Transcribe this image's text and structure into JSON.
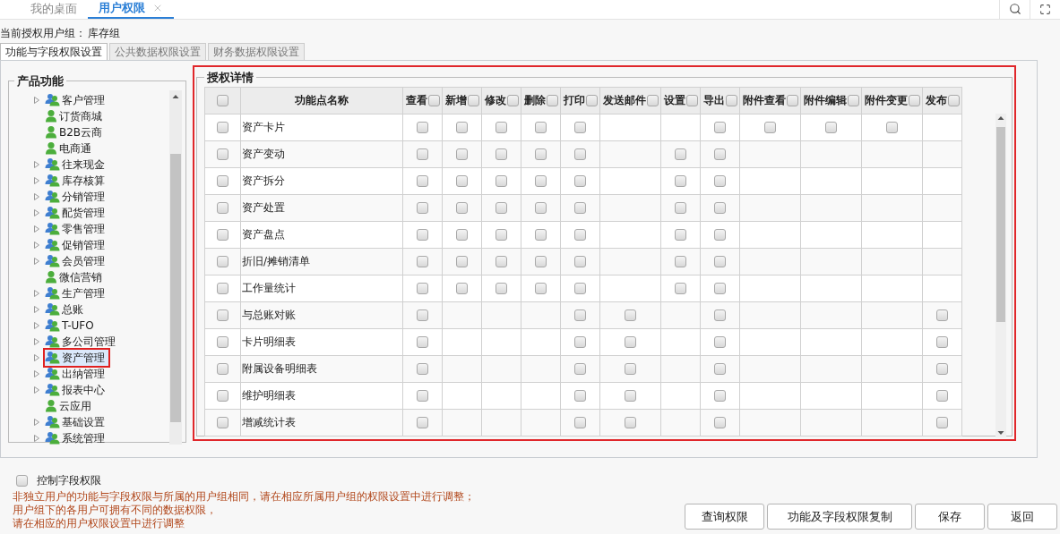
{
  "tabs": [
    {
      "label": "我的桌面",
      "selected": false,
      "closable": false
    },
    {
      "label": "用户权限",
      "selected": true,
      "closable": true
    }
  ],
  "user_group": {
    "label": "当前授权用户组：",
    "value": "库存组"
  },
  "sub_tabs": [
    {
      "label": "功能与字段权限设置",
      "selected": true
    },
    {
      "label": "公共数据权限设置",
      "selected": false
    },
    {
      "label": "财务数据权限设置",
      "selected": false
    }
  ],
  "tree": {
    "title": "产品功能",
    "items": [
      {
        "label": "客户管理",
        "kind": "group",
        "selected": false
      },
      {
        "label": "订货商城",
        "kind": "leaf",
        "selected": false
      },
      {
        "label": "B2B云商",
        "kind": "leaf",
        "selected": false
      },
      {
        "label": "电商通",
        "kind": "leaf",
        "selected": false
      },
      {
        "label": "往来现金",
        "kind": "group",
        "selected": false
      },
      {
        "label": "库存核算",
        "kind": "group",
        "selected": false
      },
      {
        "label": "分销管理",
        "kind": "group",
        "selected": false
      },
      {
        "label": "配货管理",
        "kind": "group",
        "selected": false
      },
      {
        "label": "零售管理",
        "kind": "group",
        "selected": false
      },
      {
        "label": "促销管理",
        "kind": "group",
        "selected": false
      },
      {
        "label": "会员管理",
        "kind": "group",
        "selected": false
      },
      {
        "label": "微信营销",
        "kind": "leaf",
        "selected": false
      },
      {
        "label": "生产管理",
        "kind": "group",
        "selected": false
      },
      {
        "label": "总账",
        "kind": "group",
        "selected": false
      },
      {
        "label": "T-UFO",
        "kind": "group",
        "selected": false
      },
      {
        "label": "多公司管理",
        "kind": "group",
        "selected": false
      },
      {
        "label": "资产管理",
        "kind": "group",
        "selected": true
      },
      {
        "label": "出纳管理",
        "kind": "group",
        "selected": false
      },
      {
        "label": "报表中心",
        "kind": "group",
        "selected": false
      },
      {
        "label": "云应用",
        "kind": "leaf",
        "selected": false
      },
      {
        "label": "基础设置",
        "kind": "group",
        "selected": false
      },
      {
        "label": "系统管理",
        "kind": "group",
        "selected": false
      }
    ]
  },
  "details": {
    "title": "授权详情",
    "all_checked": false,
    "columns": [
      {
        "label": "功能点名称"
      },
      {
        "label": "查看",
        "checked": false
      },
      {
        "label": "新增",
        "checked": false
      },
      {
        "label": "修改",
        "checked": false
      },
      {
        "label": "删除",
        "checked": false
      },
      {
        "label": "打印",
        "checked": false
      },
      {
        "label": "发送邮件",
        "checked": false
      },
      {
        "label": "设置",
        "checked": false
      },
      {
        "label": "导出",
        "checked": false
      },
      {
        "label": "附件查看",
        "checked": false
      },
      {
        "label": "附件编辑",
        "checked": false
      },
      {
        "label": "附件变更",
        "checked": false
      },
      {
        "label": "发布",
        "checked": false
      }
    ],
    "rows": [
      {
        "name": "资产卡片",
        "checked": false,
        "cells": [
          {
            "kind": "checkbox",
            "checked": false
          },
          {
            "kind": "checkbox",
            "checked": false
          },
          {
            "kind": "checkbox",
            "checked": false
          },
          {
            "kind": "checkbox",
            "checked": false
          },
          {
            "kind": "checkbox",
            "checked": false
          },
          {
            "kind": "blank"
          },
          {
            "kind": "blank"
          },
          {
            "kind": "checkbox",
            "checked": false
          },
          {
            "kind": "checkbox",
            "checked": false
          },
          {
            "kind": "checkbox",
            "checked": false
          },
          {
            "kind": "checkbox",
            "checked": false
          },
          {
            "kind": "blank"
          }
        ]
      },
      {
        "name": "资产变动",
        "checked": false,
        "cells": [
          {
            "kind": "checkbox",
            "checked": false
          },
          {
            "kind": "checkbox",
            "checked": false
          },
          {
            "kind": "checkbox",
            "checked": false
          },
          {
            "kind": "checkbox",
            "checked": false
          },
          {
            "kind": "checkbox",
            "checked": false
          },
          {
            "kind": "blank"
          },
          {
            "kind": "checkbox",
            "checked": false
          },
          {
            "kind": "checkbox",
            "checked": false
          },
          {
            "kind": "blank"
          },
          {
            "kind": "blank"
          },
          {
            "kind": "blank"
          },
          {
            "kind": "blank"
          }
        ]
      },
      {
        "name": "资产拆分",
        "checked": false,
        "cells": [
          {
            "kind": "checkbox",
            "checked": false
          },
          {
            "kind": "checkbox",
            "checked": false
          },
          {
            "kind": "checkbox",
            "checked": false
          },
          {
            "kind": "checkbox",
            "checked": false
          },
          {
            "kind": "checkbox",
            "checked": false
          },
          {
            "kind": "blank"
          },
          {
            "kind": "checkbox",
            "checked": false
          },
          {
            "kind": "checkbox",
            "checked": false
          },
          {
            "kind": "blank"
          },
          {
            "kind": "blank"
          },
          {
            "kind": "blank"
          },
          {
            "kind": "blank"
          }
        ]
      },
      {
        "name": "资产处置",
        "checked": false,
        "cells": [
          {
            "kind": "checkbox",
            "checked": false
          },
          {
            "kind": "checkbox",
            "checked": false
          },
          {
            "kind": "checkbox",
            "checked": false
          },
          {
            "kind": "checkbox",
            "checked": false
          },
          {
            "kind": "checkbox",
            "checked": false
          },
          {
            "kind": "blank"
          },
          {
            "kind": "checkbox",
            "checked": false
          },
          {
            "kind": "checkbox",
            "checked": false
          },
          {
            "kind": "blank"
          },
          {
            "kind": "blank"
          },
          {
            "kind": "blank"
          },
          {
            "kind": "blank"
          }
        ]
      },
      {
        "name": "资产盘点",
        "checked": false,
        "cells": [
          {
            "kind": "checkbox",
            "checked": false
          },
          {
            "kind": "checkbox",
            "checked": false
          },
          {
            "kind": "checkbox",
            "checked": false
          },
          {
            "kind": "checkbox",
            "checked": false
          },
          {
            "kind": "checkbox",
            "checked": false
          },
          {
            "kind": "blank"
          },
          {
            "kind": "checkbox",
            "checked": false
          },
          {
            "kind": "checkbox",
            "checked": false
          },
          {
            "kind": "blank"
          },
          {
            "kind": "blank"
          },
          {
            "kind": "blank"
          },
          {
            "kind": "blank"
          }
        ]
      },
      {
        "name": "折旧/摊销清单",
        "checked": false,
        "cells": [
          {
            "kind": "checkbox",
            "checked": false
          },
          {
            "kind": "checkbox",
            "checked": false
          },
          {
            "kind": "checkbox",
            "checked": false
          },
          {
            "kind": "checkbox",
            "checked": false
          },
          {
            "kind": "checkbox",
            "checked": false
          },
          {
            "kind": "blank"
          },
          {
            "kind": "checkbox",
            "checked": false
          },
          {
            "kind": "checkbox",
            "checked": false
          },
          {
            "kind": "blank"
          },
          {
            "kind": "blank"
          },
          {
            "kind": "blank"
          },
          {
            "kind": "blank"
          }
        ]
      },
      {
        "name": "工作量统计",
        "checked": false,
        "cells": [
          {
            "kind": "checkbox",
            "checked": false
          },
          {
            "kind": "checkbox",
            "checked": false
          },
          {
            "kind": "checkbox",
            "checked": false
          },
          {
            "kind": "checkbox",
            "checked": false
          },
          {
            "kind": "checkbox",
            "checked": false
          },
          {
            "kind": "blank"
          },
          {
            "kind": "checkbox",
            "checked": false
          },
          {
            "kind": "checkbox",
            "checked": false
          },
          {
            "kind": "blank"
          },
          {
            "kind": "blank"
          },
          {
            "kind": "blank"
          },
          {
            "kind": "blank"
          }
        ]
      },
      {
        "name": "与总账对账",
        "checked": false,
        "cells": [
          {
            "kind": "checkbox",
            "checked": false
          },
          {
            "kind": "blank"
          },
          {
            "kind": "blank"
          },
          {
            "kind": "blank"
          },
          {
            "kind": "checkbox",
            "checked": false
          },
          {
            "kind": "checkbox",
            "checked": false
          },
          {
            "kind": "blank"
          },
          {
            "kind": "checkbox",
            "checked": false
          },
          {
            "kind": "blank"
          },
          {
            "kind": "blank"
          },
          {
            "kind": "blank"
          },
          {
            "kind": "checkbox",
            "checked": false
          }
        ]
      },
      {
        "name": "卡片明细表",
        "checked": false,
        "cells": [
          {
            "kind": "checkbox",
            "checked": false
          },
          {
            "kind": "blank"
          },
          {
            "kind": "blank"
          },
          {
            "kind": "blank"
          },
          {
            "kind": "checkbox",
            "checked": false
          },
          {
            "kind": "checkbox",
            "checked": false
          },
          {
            "kind": "blank"
          },
          {
            "kind": "checkbox",
            "checked": false
          },
          {
            "kind": "blank"
          },
          {
            "kind": "blank"
          },
          {
            "kind": "blank"
          },
          {
            "kind": "checkbox",
            "checked": false
          }
        ]
      },
      {
        "name": "附属设备明细表",
        "checked": false,
        "cells": [
          {
            "kind": "checkbox",
            "checked": false
          },
          {
            "kind": "blank"
          },
          {
            "kind": "blank"
          },
          {
            "kind": "blank"
          },
          {
            "kind": "checkbox",
            "checked": false
          },
          {
            "kind": "checkbox",
            "checked": false
          },
          {
            "kind": "blank"
          },
          {
            "kind": "checkbox",
            "checked": false
          },
          {
            "kind": "blank"
          },
          {
            "kind": "blank"
          },
          {
            "kind": "blank"
          },
          {
            "kind": "checkbox",
            "checked": false
          }
        ]
      },
      {
        "name": "维护明细表",
        "checked": false,
        "cells": [
          {
            "kind": "checkbox",
            "checked": false
          },
          {
            "kind": "blank"
          },
          {
            "kind": "blank"
          },
          {
            "kind": "blank"
          },
          {
            "kind": "checkbox",
            "checked": false
          },
          {
            "kind": "checkbox",
            "checked": false
          },
          {
            "kind": "blank"
          },
          {
            "kind": "checkbox",
            "checked": false
          },
          {
            "kind": "blank"
          },
          {
            "kind": "blank"
          },
          {
            "kind": "blank"
          },
          {
            "kind": "checkbox",
            "checked": false
          }
        ]
      },
      {
        "name": "增减统计表",
        "checked": false,
        "cells": [
          {
            "kind": "checkbox",
            "checked": false
          },
          {
            "kind": "blank"
          },
          {
            "kind": "blank"
          },
          {
            "kind": "blank"
          },
          {
            "kind": "checkbox",
            "checked": false
          },
          {
            "kind": "checkbox",
            "checked": false
          },
          {
            "kind": "blank"
          },
          {
            "kind": "checkbox",
            "checked": false
          },
          {
            "kind": "blank"
          },
          {
            "kind": "blank"
          },
          {
            "kind": "blank"
          },
          {
            "kind": "checkbox",
            "checked": false
          }
        ]
      }
    ]
  },
  "field_control": {
    "label": "控制字段权限",
    "checked": false
  },
  "notes": [
    "非独立用户的功能与字段权限与所属的用户组相同，请在相应所属用户组的权限设置中进行调整；",
    "用户组下的各用户可拥有不同的数据权限，",
    "请在相应的用户权限设置中进行调整"
  ],
  "buttons": [
    "查询权限",
    "功能及字段权限复制",
    "保存",
    "返回"
  ]
}
